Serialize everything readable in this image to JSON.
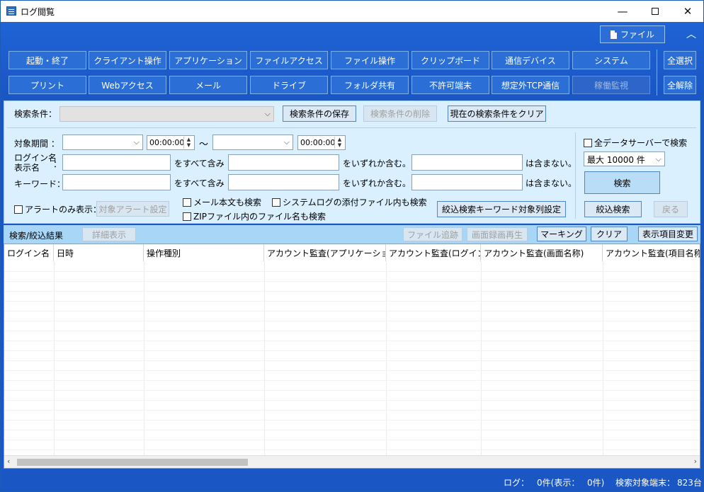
{
  "window": {
    "title": "ログ閲覧",
    "minimize_icon": "minimize-icon",
    "maximize_icon": "maximize-icon",
    "close_icon": "close-icon"
  },
  "toolbar": {
    "file_label": "ファイル",
    "collapse_icon": "chevron-up-icon",
    "select_all": "全選択",
    "deselect_all": "全解除",
    "categories_row1": [
      "起動・終了",
      "クライアント操作",
      "アプリケーション",
      "ファイルアクセス",
      "ファイル操作",
      "クリップボード",
      "通信デバイス",
      "システム"
    ],
    "categories_row2": [
      "プリント",
      "Webアクセス",
      "メール",
      "ドライブ",
      "フォルダ共有",
      "不許可端末",
      "想定外TCP通信",
      "稼働監視"
    ]
  },
  "search": {
    "condition_label": "検索条件：",
    "save_condition": "検索条件の保存",
    "delete_condition": "検索条件の削除",
    "clear_condition": "現在の検索条件をクリア",
    "period_label": "対象期間 ：",
    "time_from": "00:00:00",
    "time_to": "00:00:00",
    "tilde": "～",
    "login_label_1": "ログイン名",
    "login_label_2": "表示名",
    "login_colon": "：",
    "keyword_label": "キーワード：",
    "contains_all": "をすべて含み",
    "contains_any": "をいずれか含む。",
    "not_contains": "は含まない。",
    "alert_only": "アラートのみ表示：",
    "alert_setting": "対象アラート設定",
    "mail_body": "メール本文も検索",
    "syslog_attach": "システムログの添付ファイル内も検索",
    "zip_names": "ZIPファイル内のファイル名も検索",
    "refine_column_setting": "絞込検索キーワード対象列設定",
    "all_servers": "全データサーバーで検索",
    "max_count": "最大 10000 件",
    "search_button": "検索",
    "refine_button": "絞込検索",
    "back_button": "戻る"
  },
  "results": {
    "title": "検索/絞込結果",
    "detail": "詳細表示",
    "file_trace": "ファイル追跡",
    "screen_playback": "画面録画再生",
    "marking": "マーキング",
    "clear": "クリア",
    "change_columns": "表示項目変更",
    "columns": [
      "ログイン名",
      "日時",
      "操作種別",
      "アカウント監査(アプリケーショ...",
      "アカウント監査(ログイン...",
      "アカウント監査(画面名称)",
      "アカウント監査(項目名称"
    ]
  },
  "status": {
    "log_label": "ログ：",
    "log_count": "0件(表示：",
    "display_count": "0件)",
    "terminals_label": "検索対象端末：",
    "terminals_count": "823台"
  }
}
